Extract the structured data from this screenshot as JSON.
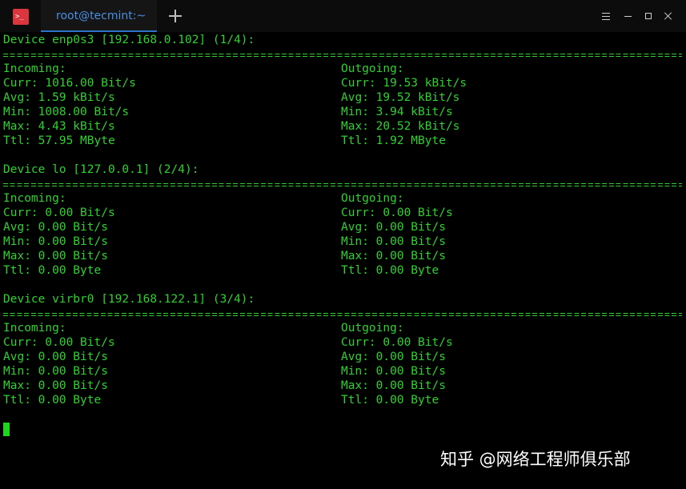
{
  "window": {
    "tab_title": "root@tecmint:~",
    "app_icon": "terminal-icon",
    "app_icon_glyph": ">_",
    "controls": [
      "menu-icon",
      "minimize-icon",
      "maximize-icon",
      "close-icon"
    ],
    "colors": {
      "terminal_text": "#2ed12e",
      "background": "#000000",
      "tab_accent": "#2c73c9",
      "app_icon": "#d9363e"
    }
  },
  "devices": [
    {
      "header": "Device enp0s3 [192.168.0.102] (1/4):",
      "incoming": {
        "title": "Incoming:",
        "curr": "Curr: 1016.00 Bit/s",
        "avg": "Avg: 1.59 kBit/s",
        "min": "Min: 1008.00 Bit/s",
        "max": "Max: 4.43 kBit/s",
        "ttl": "Ttl: 57.95 MByte"
      },
      "outgoing": {
        "title": "Outgoing:",
        "curr": "Curr: 19.53 kBit/s",
        "avg": "Avg: 19.52 kBit/s",
        "min": "Min: 3.94 kBit/s",
        "max": "Max: 20.52 kBit/s",
        "ttl": "Ttl: 1.92 MByte"
      }
    },
    {
      "header": "Device lo [127.0.0.1] (2/4):",
      "incoming": {
        "title": "Incoming:",
        "curr": "Curr: 0.00 Bit/s",
        "avg": "Avg: 0.00 Bit/s",
        "min": "Min: 0.00 Bit/s",
        "max": "Max: 0.00 Bit/s",
        "ttl": "Ttl: 0.00 Byte"
      },
      "outgoing": {
        "title": "Outgoing:",
        "curr": "Curr: 0.00 Bit/s",
        "avg": "Avg: 0.00 Bit/s",
        "min": "Min: 0.00 Bit/s",
        "max": "Max: 0.00 Bit/s",
        "ttl": "Ttl: 0.00 Byte"
      }
    },
    {
      "header": "Device virbr0 [192.168.122.1] (3/4):",
      "incoming": {
        "title": "Incoming:",
        "curr": "Curr: 0.00 Bit/s",
        "avg": "Avg: 0.00 Bit/s",
        "min": "Min: 0.00 Bit/s",
        "max": "Max: 0.00 Bit/s",
        "ttl": "Ttl: 0.00 Byte"
      },
      "outgoing": {
        "title": "Outgoing:",
        "curr": "Curr: 0.00 Bit/s",
        "avg": "Avg: 0.00 Bit/s",
        "min": "Min: 0.00 Bit/s",
        "max": "Max: 0.00 Bit/s",
        "ttl": "Ttl: 0.00 Byte"
      }
    }
  ],
  "watermark": "知乎 @网络工程师俱乐部"
}
